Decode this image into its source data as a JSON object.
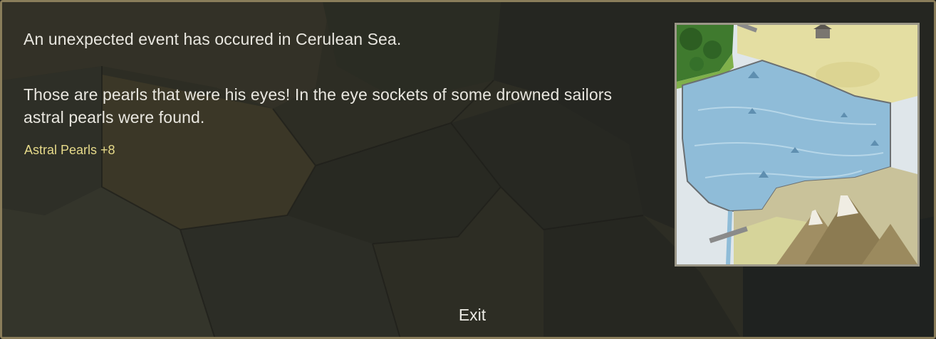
{
  "event_dialog": {
    "intro": "An unexpected event has occured in Cerulean Sea.",
    "description": "Those are pearls that were his eyes! In the eye sockets of some drowned sailors astral pearls were found.",
    "reward": "Astral Pearls +8",
    "exit_label": "Exit"
  },
  "colors": {
    "text": "#e8e6df",
    "reward": "#e6da8a",
    "frame_border": "#8a7d5a",
    "sea": "#8fbcd8",
    "grassland": "#e2dca0",
    "forest": "#3f7a2e",
    "snow": "#dde5ea",
    "mountain": "#b6a679"
  },
  "icons": {
    "event_image": "cerulean-sea-terrain-tile",
    "background": "world-map"
  }
}
